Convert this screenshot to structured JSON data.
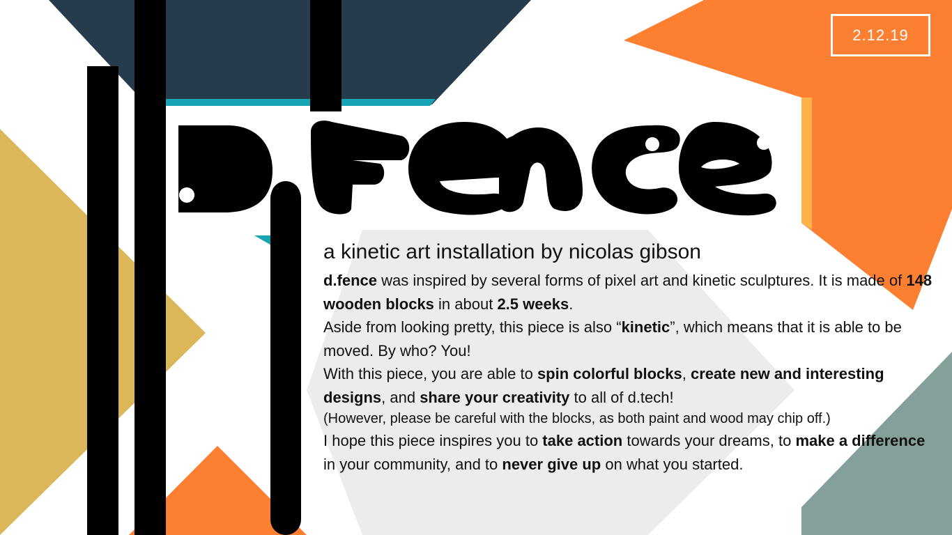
{
  "date": "2.12.19",
  "title": "d.fence",
  "subtitle": "a kinetic art installation by nicolas gibson",
  "paragraphs": [
    [
      {
        "t": "d.fence",
        "b": true
      },
      {
        "t": " was inspired by several forms of pixel art and kinetic sculptures. It is made of ",
        "b": false
      },
      {
        "t": "148 wooden blocks",
        "b": true
      },
      {
        "t": " in about ",
        "b": false
      },
      {
        "t": "2.5 weeks",
        "b": true
      },
      {
        "t": ".",
        "b": false
      }
    ],
    [
      {
        "t": "Aside from looking pretty, this piece is also “",
        "b": false
      },
      {
        "t": "kinetic",
        "b": true
      },
      {
        "t": "”, which means that it is able to be moved. By who? You!",
        "b": false
      }
    ],
    [
      {
        "t": "With this piece, you are able to ",
        "b": false
      },
      {
        "t": "spin colorful blocks",
        "b": true
      },
      {
        "t": ", ",
        "b": false
      },
      {
        "t": "create new and interesting designs",
        "b": true
      },
      {
        "t": ", and ",
        "b": false
      },
      {
        "t": "share your creativity",
        "b": true
      },
      {
        "t": " to all of d.tech!",
        "b": false
      }
    ],
    [
      {
        "t": "(However, please be careful with the blocks, as both paint and wood may chip off.)",
        "b": false,
        "small": true
      }
    ],
    [
      {
        "t": "I hope this piece inspires you to ",
        "b": false
      },
      {
        "t": "take action",
        "b": true
      },
      {
        "t": " towards your dreams, to ",
        "b": false
      },
      {
        "t": "make a difference",
        "b": true
      },
      {
        "t": " in your community, and to ",
        "b": false
      },
      {
        "t": "never give up",
        "b": true
      },
      {
        "t": " on what you started.",
        "b": false
      }
    ]
  ],
  "colors": {
    "navy": "#263c4d",
    "teal": "#16a3b3",
    "orange": "#fd8032",
    "light_orange": "#fdb24a",
    "mustard": "#dcb75a",
    "sage": "#85a09a",
    "light_gray": "#ececec",
    "black": "#000000"
  }
}
